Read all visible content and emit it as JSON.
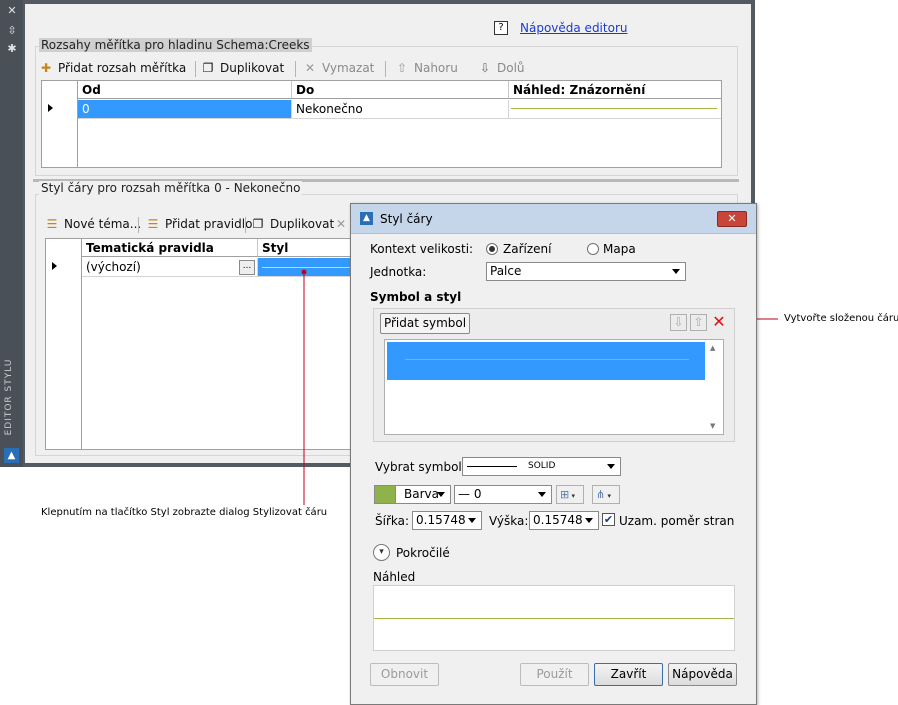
{
  "editor": {
    "sidebar_title": "EDITOR STYLU",
    "help_link": "Nápověda editoru",
    "scale_group_title": "Rozsahy měřítka pro hladinu Schema:Creeks",
    "scale_toolbar": {
      "add": "Přidat rozsah měřítka",
      "duplicate": "Duplikovat",
      "delete": "Vymazat",
      "up": "Nahoru",
      "down": "Dolů"
    },
    "scale_table": {
      "headers": [
        "Od",
        "Do",
        "Náhled: Znázornění"
      ],
      "rows": [
        {
          "from": "0",
          "to": "Nekonečno"
        }
      ]
    },
    "style_group_title": "Styl čáry pro rozsah měřítka 0 - Nekonečno",
    "style_toolbar": {
      "new_theme": "Nové téma...",
      "add_rule": "Přidat pravidlo",
      "duplicate": "Duplikovat"
    },
    "style_table": {
      "headers": [
        "Tematická pravidla",
        "Styl"
      ],
      "rows": [
        {
          "rule": "(výchozí)",
          "ellipsis": "..."
        }
      ]
    }
  },
  "dialog": {
    "title": "Styl čáry",
    "context_label": "Kontext velikosti:",
    "context_device": "Zařízení",
    "context_map": "Mapa",
    "unit_label": "Jednotka:",
    "unit_value": "Palce",
    "symbol_style_heading": "Symbol a styl",
    "add_symbol": "Přidat symbol",
    "select_symbol_label": "Vybrat symbol:",
    "select_symbol_value": "SOLID",
    "color_label": "Barva",
    "color_hex": "#8fb24a",
    "lineweight_value": "0",
    "width_label": "Šířka:",
    "width_value": "0.15748",
    "height_label": "Výška:",
    "height_value": "0.15748",
    "aspect_label": "Uzam. poměr stran",
    "advanced_label": "Pokročilé",
    "preview_label": "Náhled",
    "buttons": {
      "refresh": "Obnovit",
      "apply": "Použít",
      "close": "Zavřít",
      "help": "Nápověda"
    }
  },
  "callouts": {
    "compound_line": "Vytvořte složenou čáru",
    "style_button_hint": "Klepnutím na tlačítko Styl zobrazte dialog Stylizovat čáru"
  },
  "colors": {
    "selection_blue": "#3399ff",
    "callout_red": "#c0001c",
    "preview_line": "#a4b84a"
  }
}
